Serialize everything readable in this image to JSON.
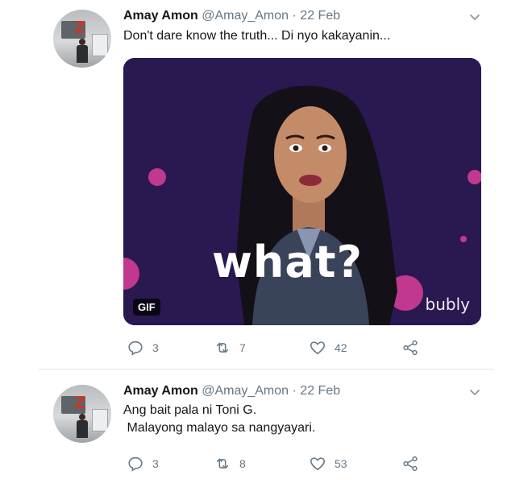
{
  "tweets": [
    {
      "name": "Amay Amon",
      "handle": "@Amay_Amon",
      "separator": "·",
      "date": "22 Feb",
      "lines": [
        "Don't dare know the truth... Di nyo kakayanin..."
      ],
      "media": {
        "badge": "GIF",
        "caption": "what?",
        "brand": "bubly"
      },
      "replies": "3",
      "retweets": "7",
      "likes": "42"
    },
    {
      "name": "Amay Amon",
      "handle": "@Amay_Amon",
      "separator": "·",
      "date": "22 Feb",
      "lines": [
        "Ang bait pala ni Toni G.",
        " Malayong malayo sa nangyayari."
      ],
      "replies": "3",
      "retweets": "8",
      "likes": "53"
    }
  ],
  "colors": {
    "accent": "#1da1f2",
    "muted": "#657786",
    "media_bg": "#2a1850",
    "dot": "#c0398f"
  },
  "icons": [
    "chevron-down-icon",
    "reply-icon",
    "retweet-icon",
    "like-icon",
    "share-icon"
  ]
}
